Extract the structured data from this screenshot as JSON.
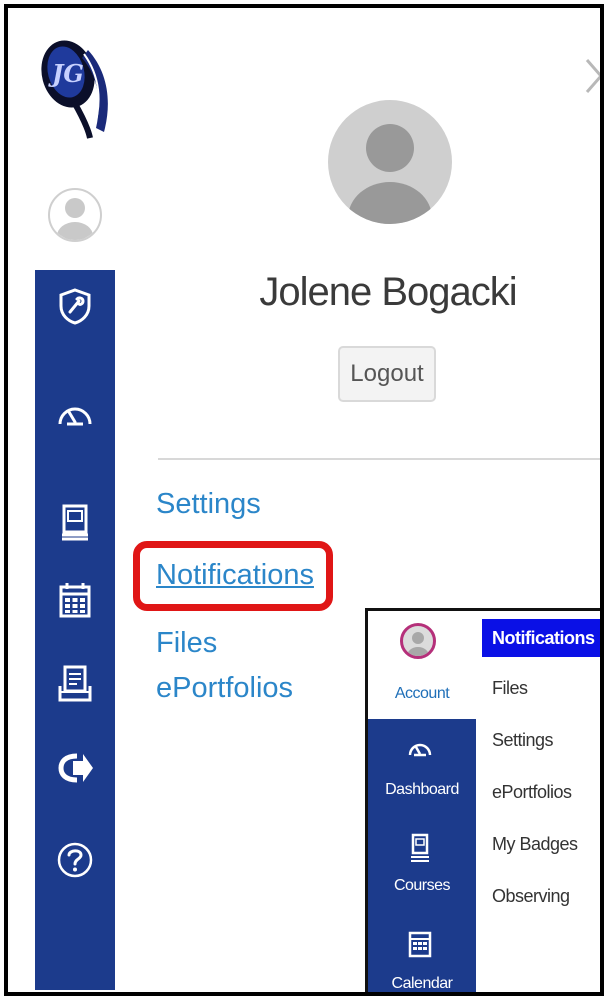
{
  "account": {
    "user_name": "Jolene Bogacki",
    "logout_label": "Logout",
    "links": [
      "Settings",
      "Notifications",
      "Files",
      "ePortfolios"
    ],
    "highlighted_link": "Notifications"
  },
  "global_nav": {
    "icons": [
      "admin-icon",
      "dashboard-icon",
      "courses-icon",
      "calendar-icon",
      "inbox-icon",
      "commons-icon",
      "help-icon"
    ]
  },
  "inset": {
    "nav": [
      {
        "label": "Account",
        "icon": "account-avatar-icon"
      },
      {
        "label": "Dashboard",
        "icon": "dashboard-icon"
      },
      {
        "label": "Courses",
        "icon": "courses-icon"
      },
      {
        "label": "Calendar",
        "icon": "calendar-icon"
      }
    ],
    "menu": [
      "Notifications",
      "Files",
      "Settings",
      "ePortfolios",
      "My Badges",
      "Observing"
    ],
    "active_menu": "Notifications"
  },
  "colors": {
    "nav_blue": "#1c3b8c",
    "link_blue": "#2b86c9",
    "highlight_red": "#e01616",
    "active_blue": "#0a10e6"
  }
}
